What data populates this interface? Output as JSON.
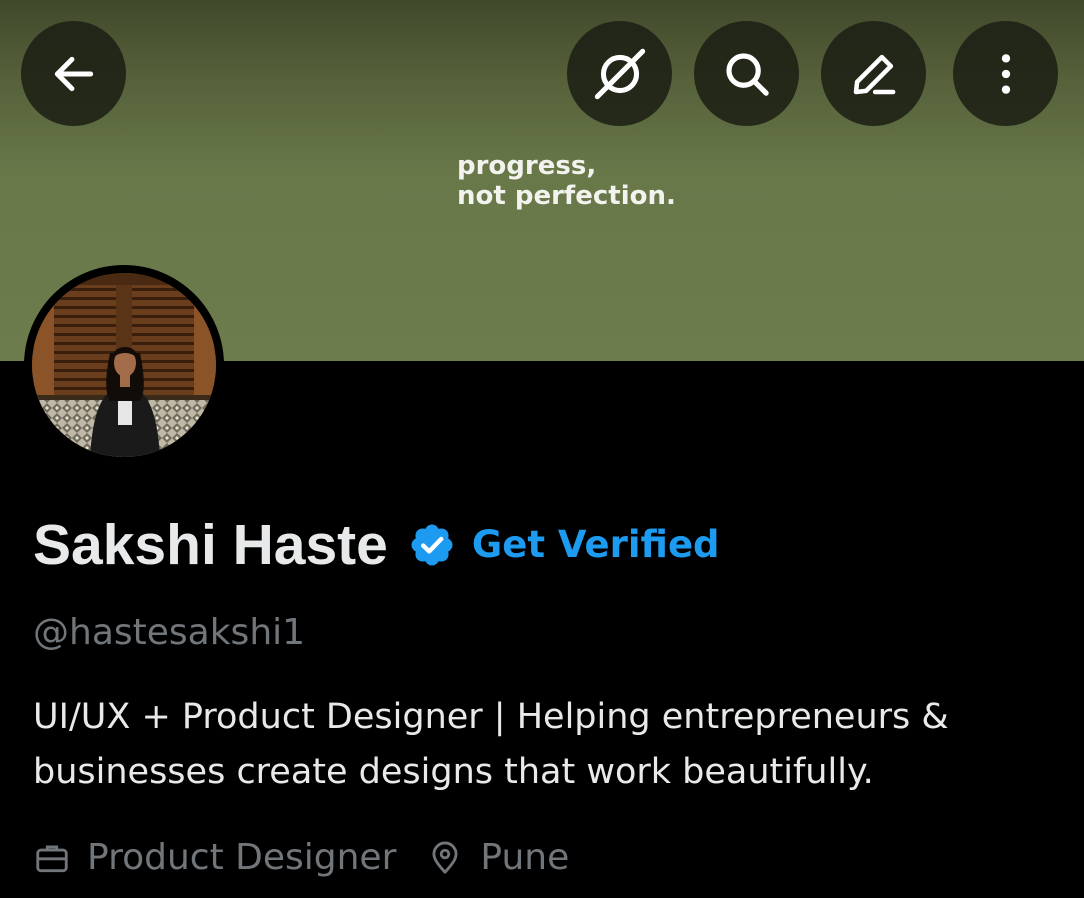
{
  "header": {
    "banner_text_line1": "progress,",
    "banner_text_line2": "not perfection.",
    "buttons": {
      "back": "arrow-left-icon",
      "grok": "grok-icon",
      "search": "search-icon",
      "edit": "pencil-icon",
      "more": "more-vertical-icon"
    }
  },
  "profile": {
    "display_name": "Sakshi Haste",
    "verified_badge": "verified-badge-icon",
    "get_verified_label": "Get Verified",
    "handle": "@hastesakshi1",
    "bio": "UI/UX + Product Designer | Helping entrepreneurs & businesses create designs that work beautifully.",
    "profession": "Product Designer",
    "location": "Pune"
  },
  "colors": {
    "accent": "#1d9bf0",
    "text_primary": "#e7e9ea",
    "text_secondary": "#71767b",
    "background": "#000000",
    "banner": "#6c7c4c"
  }
}
